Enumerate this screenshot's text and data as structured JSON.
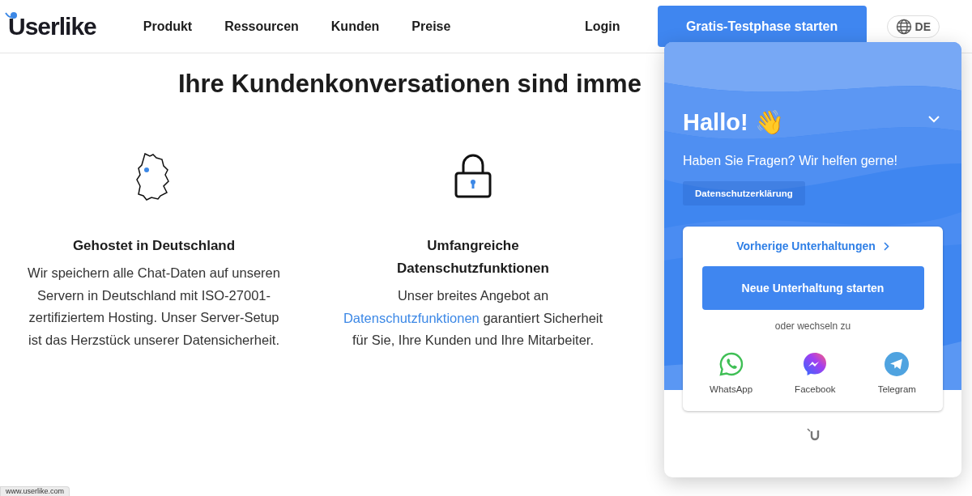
{
  "header": {
    "logo": "Userlike",
    "nav": [
      "Produkt",
      "Ressourcen",
      "Kunden",
      "Preise"
    ],
    "login": "Login",
    "cta": "Gratis-Testphase starten",
    "language": "DE"
  },
  "heading": "Ihre Kundenkonversationen sind imme",
  "features": [
    {
      "kind": "map",
      "title": "Gehostet in Deutschland",
      "text": "Wir speichern alle Chat-Daten auf unseren Servern in Deutschland mit ISO-27001-zertifiziertem Hosting. Unser Server-Setup ist das Herzstück unserer Datensicherheit."
    },
    {
      "kind": "lock",
      "title": "Umfangreiche Datenschutzfunktionen",
      "text_before": "Unser breites Angebot an",
      "link": "Datenschutzfunktionen",
      "text_after": "garantiert Sicherheit für Sie, Ihre Kunden und Ihre Mitarbeiter."
    }
  ],
  "chat_widget": {
    "greeting": "Hallo! 👋",
    "subtitle": "Haben Sie Fragen? Wir helfen gerne!",
    "privacy": "Datenschutzerklärung",
    "previous": "Vorherige Unterhaltungen",
    "start": "Neue Unterhaltung starten",
    "switch_label": "oder wechseln zu",
    "channels": [
      {
        "kind": "whatsapp",
        "label": "WhatsApp"
      },
      {
        "kind": "messenger",
        "label": "Facebook"
      },
      {
        "kind": "telegram",
        "label": "Telegram"
      }
    ]
  },
  "status_url": "www.userlike.com"
}
